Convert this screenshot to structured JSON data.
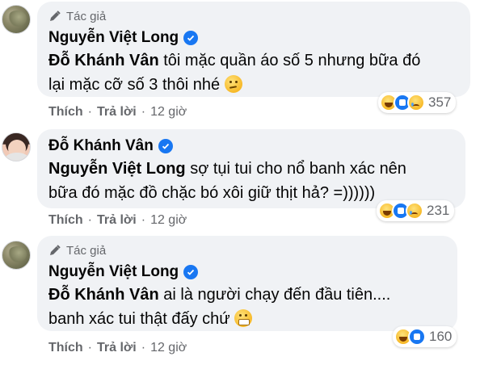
{
  "comments": [
    {
      "author_tag": "Tác giả",
      "author": "Nguyễn Việt Long",
      "mention": "Đỗ Khánh Vân",
      "text_line1": " tôi mặc quần áo số 5 nhưng bữa đó",
      "text_line2": "lại mặc cỡ số 3 thôi nhé ",
      "emoji": "smirk-icon",
      "like": "Thích",
      "reply": "Trả lời",
      "time": "12 giờ",
      "reaction_count": "357",
      "reactions": [
        "haha",
        "like",
        "sad"
      ]
    },
    {
      "author_tag": "",
      "author": "Đỗ Khánh Vân",
      "mention": "Nguyễn Việt Long",
      "text_line1": " sợ tụi tui cho nổ banh xác nên",
      "text_line2": "bữa đó mặc đồ chặc bó xôi giữ thịt hả? =))))))",
      "emoji": "",
      "like": "Thích",
      "reply": "Trả lời",
      "time": "12 giờ",
      "reaction_count": "231",
      "reactions": [
        "haha",
        "like",
        "sad"
      ]
    },
    {
      "author_tag": "Tác giả",
      "author": "Nguyễn Việt Long",
      "mention": "Đỗ Khánh Vân",
      "text_line1": " ai là người chạy đến đầu tiên....",
      "text_line2": "banh xác tui thật đấy chứ ",
      "emoji": "grimace-icon",
      "like": "Thích",
      "reply": "Trả lời",
      "time": "12 giờ",
      "reaction_count": "160",
      "reactions": [
        "haha",
        "like"
      ]
    }
  ],
  "colors": {
    "bubble": "#f0f2f5",
    "meta_text": "#65676b",
    "verified": "#1877f2"
  }
}
